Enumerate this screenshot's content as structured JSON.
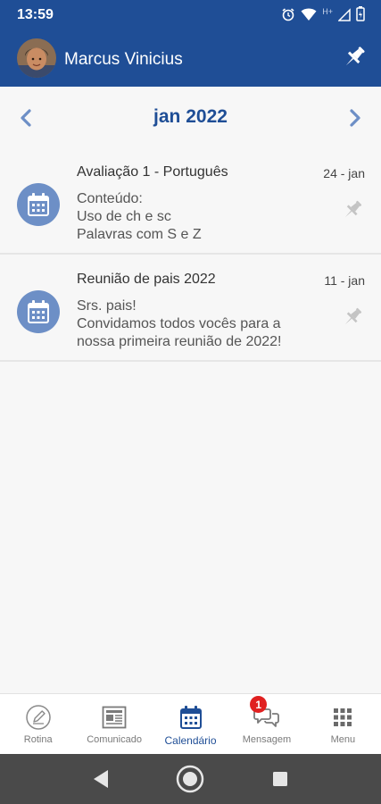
{
  "status_bar": {
    "time": "13:59",
    "network_label": "H+"
  },
  "header": {
    "user_name": "Marcus Vinicius",
    "avatar_icon": "child-avatar-photo",
    "pin_icon": "pushpin-icon",
    "background_color": "#1f4e96"
  },
  "month_nav": {
    "label": "jan 2022",
    "prev_icon": "chevron-left-icon",
    "next_icon": "chevron-right-icon"
  },
  "events": [
    {
      "title": "Avaliação 1 - Português",
      "date": "24 - jan",
      "body": [
        "Conteúdo:",
        "Uso de ch e sc",
        "Palavras com S e Z"
      ],
      "icon": "calendar-icon"
    },
    {
      "title": "Reunião de pais 2022",
      "date": "11 - jan",
      "body": [
        "Srs. pais!",
        "Convidamos todos vocês para a",
        "nossa primeira reunião de 2022!"
      ],
      "icon": "calendar-icon"
    }
  ],
  "bottom_nav": {
    "tabs": [
      {
        "label": "Rotina",
        "icon": "pencil-circle-icon"
      },
      {
        "label": "Comunicado",
        "icon": "newspaper-icon"
      },
      {
        "label": "Calendário",
        "icon": "calendar-icon",
        "active": true
      },
      {
        "label": "Mensagem",
        "icon": "chat-bubbles-icon",
        "badge": "1"
      },
      {
        "label": "Menu",
        "icon": "grid-icon"
      }
    ]
  },
  "colors": {
    "accent": "#1f4e96",
    "event_icon_bg": "#6d8fc6",
    "badge": "#e02020"
  }
}
